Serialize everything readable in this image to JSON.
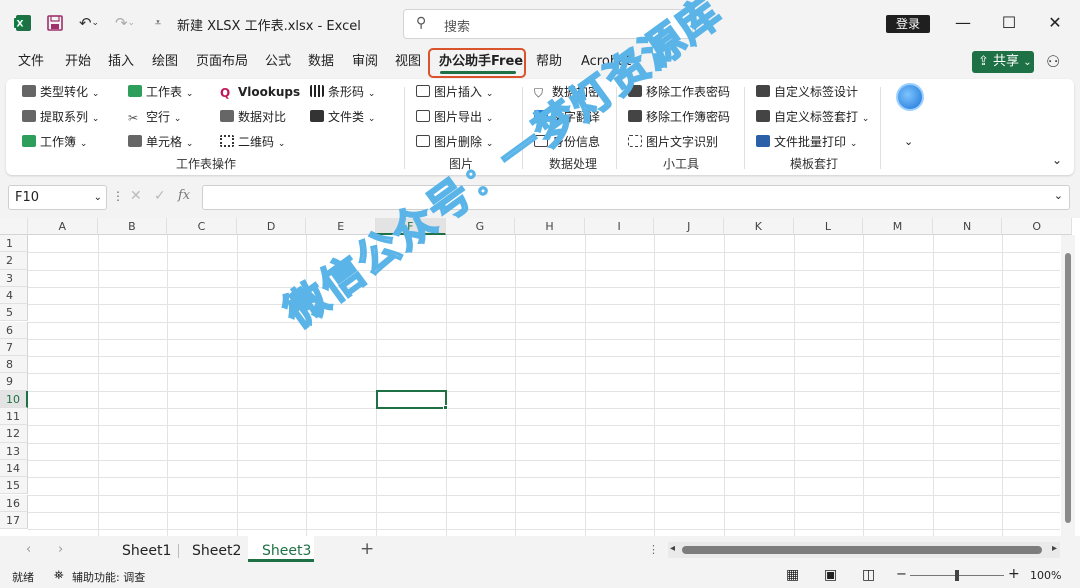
{
  "title": "新建 XLSX 工作表.xlsx  -  Excel",
  "search_placeholder": "搜索",
  "login": "登录",
  "tabs": [
    "文件",
    "开始",
    "插入",
    "绘图",
    "页面布局",
    "公式",
    "数据",
    "审阅",
    "视图",
    "办公助手Free",
    "帮助",
    "Acrobat"
  ],
  "share": "共享",
  "ribbon": {
    "g1": {
      "label": "工作表操作",
      "items": [
        "类型转化",
        "提取系列",
        "工作簿",
        "工作表",
        "空行",
        "单元格",
        "Vlookups",
        "数据对比",
        "二维码",
        "条形码",
        "文件类"
      ]
    },
    "g2": {
      "label": "图片",
      "items": [
        "图片插入",
        "图片导出",
        "图片删除"
      ]
    },
    "g3": {
      "label": "数据处理",
      "items": [
        "数据加密",
        "文字翻译",
        "身份信息"
      ]
    },
    "g4": {
      "label": "小工具",
      "items": [
        "移除工作表密码",
        "移除工作簿密码",
        "图片文字识别"
      ]
    },
    "g5": {
      "label": "模板套打",
      "items": [
        "自定义标签设计",
        "自定义标签套打",
        "文件批量打印"
      ]
    }
  },
  "namebox": "F10",
  "fx": "fx",
  "columns": [
    "A",
    "B",
    "C",
    "D",
    "E",
    "F",
    "G",
    "H",
    "I",
    "J",
    "K",
    "L",
    "M",
    "N",
    "O"
  ],
  "rows": [
    "1",
    "2",
    "3",
    "4",
    "5",
    "6",
    "7",
    "8",
    "9",
    "10",
    "11",
    "12",
    "13",
    "14",
    "15",
    "16",
    "17"
  ],
  "sheets": [
    "Sheet1",
    "Sheet2",
    "Sheet3"
  ],
  "status": {
    "ready": "就绪",
    "accessibility": "辅助功能: 调查",
    "zoom": "100%"
  },
  "watermark": "微信公众号：一梦灯资源库",
  "colors": {
    "accent": "#1e7145",
    "highlight": "#d9532c"
  }
}
